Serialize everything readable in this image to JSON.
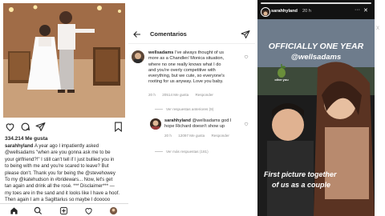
{
  "post": {
    "like_count": "334.214 Me gusta",
    "caption_username": "sarahhyland",
    "caption_lines": [
      "A year ago I impatiently asked",
      "@wellsadams \"when are you gonna ask me to be",
      "your girlfriend?!\" I still can't tell if I just bullied you in",
      "to being with me and you're scared to leave? But",
      "please don't. Thank you for being the @stevehowey",
      "To my @katehudson in #bridewars... Now, let's get",
      "tan again and drink all the rosé. *** Disclaimer*** —",
      "my toes are in the sand and it looks like I have a hoof.",
      "Then again I am a Sagittarius so maybe I dooooo"
    ],
    "icons": [
      "heart-icon",
      "comment-icon",
      "share-icon",
      "bookmark-icon"
    ],
    "tab_icons": [
      "home-icon",
      "search-icon",
      "new-post-icon",
      "activity-icon",
      "profile-icon"
    ]
  },
  "comments": {
    "title": "Comentarios",
    "items": [
      {
        "username": "wellsadams",
        "lines": [
          "I've always thought of us",
          "more as a Chandler/ Monica situation,",
          "where no one really knows what I do",
          "and you're overly competitive with",
          "everything, but we cute, so everyone's",
          "rooting for us anyway. Love you baby."
        ],
        "time": "20 h",
        "likes": "20514 Me gusta",
        "reply": "Responder",
        "view_replies": "Ver respuestas anteriores (9)"
      },
      {
        "username": "sarahhyland",
        "lines": [
          "@wellsadams god I",
          "hope Richard doesn't show up"
        ],
        "time": "20 h",
        "likes": "12097 Me gusta",
        "reply": "Responder",
        "view_replies": "Ver más respuestas (181)"
      }
    ]
  },
  "story": {
    "username": "sarahhyland",
    "time": "20 h",
    "more": "···",
    "close": "✕",
    "headline": "OFFICIALLY ONE YEAR",
    "handle": "@wellsadams",
    "sticker_label": "olive you",
    "caption_line1": "First picture together",
    "caption_line2": "of us as a couple",
    "edge_glyph": "x"
  },
  "colors": {
    "link": "#003569",
    "muted": "#8e8e8e",
    "story_bg": "#121212"
  }
}
